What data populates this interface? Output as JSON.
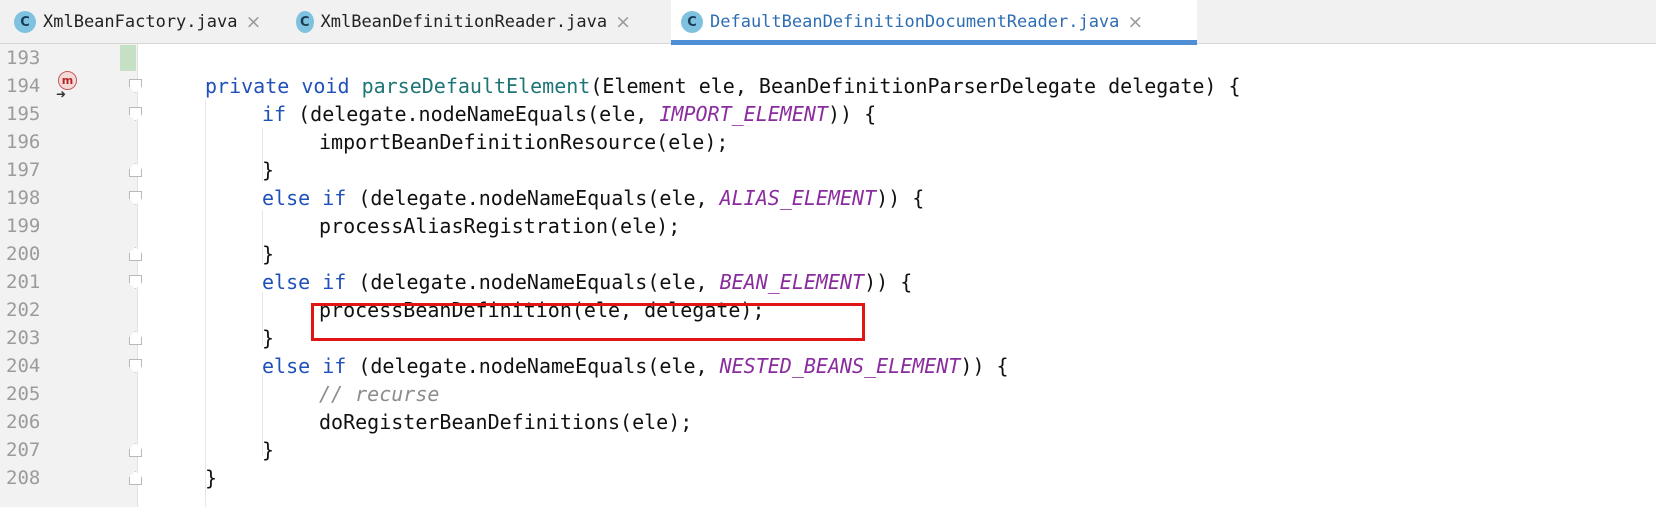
{
  "tabs": [
    {
      "icon": "C",
      "label": "XmlBeanFactory.java",
      "active": false
    },
    {
      "icon": "C",
      "label": "XmlBeanDefinitionReader.java",
      "active": false
    },
    {
      "icon": "C",
      "label": "DefaultBeanDefinitionDocumentReader.java",
      "active": true
    }
  ],
  "tab_close_glyph": "×",
  "gutter": {
    "method_marker": "m",
    "override_icon": "down-arrow-icon"
  },
  "lines": [
    {
      "num": "193"
    },
    {
      "num": "194",
      "t1": "private",
      "t2": " ",
      "t3": "void",
      "t4": " ",
      "t5": "parseDefaultElement",
      "t6": "(Element ele, BeanDefinitionParserDelegate delegate) {"
    },
    {
      "num": "195",
      "t1": "if",
      "t2": " (delegate.nodeNameEquals(ele, ",
      "t3": "IMPORT_ELEMENT",
      "t4": ")) {"
    },
    {
      "num": "196",
      "t1": "importBeanDefinitionResource(ele);"
    },
    {
      "num": "197",
      "t1": "}"
    },
    {
      "num": "198",
      "t1": "else if",
      "t2": " (delegate.nodeNameEquals(ele, ",
      "t3": "ALIAS_ELEMENT",
      "t4": ")) {"
    },
    {
      "num": "199",
      "t1": "processAliasRegistration(ele);"
    },
    {
      "num": "200",
      "t1": "}"
    },
    {
      "num": "201",
      "t1": "else if",
      "t2": " (delegate.nodeNameEquals(ele, ",
      "t3": "BEAN_ELEMENT",
      "t4": ")) {"
    },
    {
      "num": "202",
      "t1": "processBeanDefinition(ele, delegate);"
    },
    {
      "num": "203",
      "t1": "}"
    },
    {
      "num": "204",
      "t1": "else if",
      "t2": " (delegate.nodeNameEquals(ele, ",
      "t3": "NESTED_BEANS_ELEMENT",
      "t4": ")) {"
    },
    {
      "num": "205",
      "t1": "// recurse"
    },
    {
      "num": "206",
      "t1": "doRegisterBeanDefinitions(ele);"
    },
    {
      "num": "207",
      "t1": "}"
    },
    {
      "num": "208",
      "t1": "}"
    }
  ],
  "colors": {
    "keyword": "#2050b8",
    "method_declaration": "#1f7575",
    "constant": "#8a2c9e",
    "comment": "#8c8c8c",
    "highlight_box": "#e01515",
    "active_tab_underline": "#4d8ed4"
  }
}
